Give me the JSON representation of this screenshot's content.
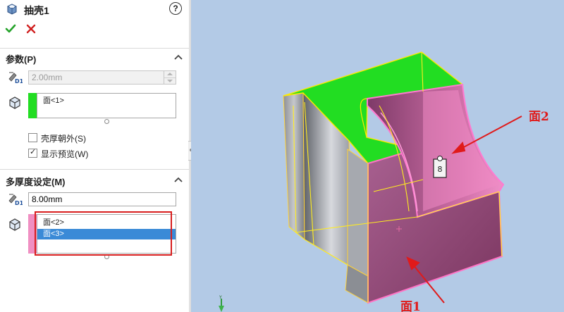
{
  "feature": {
    "title": "抽壳1",
    "icon": "shell-feature-icon",
    "help_icon_text": "?"
  },
  "actions": {
    "ok_icon": "check-icon",
    "cancel_icon": "close-icon"
  },
  "parameters": {
    "title": "参数(P)",
    "thickness_value": "2.00mm",
    "faces_to_remove": [
      "面<1>"
    ],
    "faces_strip_color": "#22dd22",
    "shell_outward_label": "壳厚朝外(S)",
    "shell_outward_checked": false,
    "show_preview_label": "显示预览(W)",
    "show_preview_checked": true
  },
  "multi_thickness": {
    "title": "多厚度设定(M)",
    "thickness_value": "8.00mm",
    "faces": [
      "面<2>",
      "面<3>"
    ],
    "selected_index": 1,
    "faces_strip_color": "#f08fc2"
  },
  "viewport": {
    "background": "#b3cae6",
    "callout_value": "8",
    "annotation_face1": "面1",
    "annotation_face2": "面2",
    "annotation_color": "#e01a1a"
  },
  "colors": {
    "highlight_border": "#d81e1e",
    "selection_blue": "#3a8ad7",
    "face_green": "#22dd22",
    "face_pink": "#e35fa4"
  }
}
